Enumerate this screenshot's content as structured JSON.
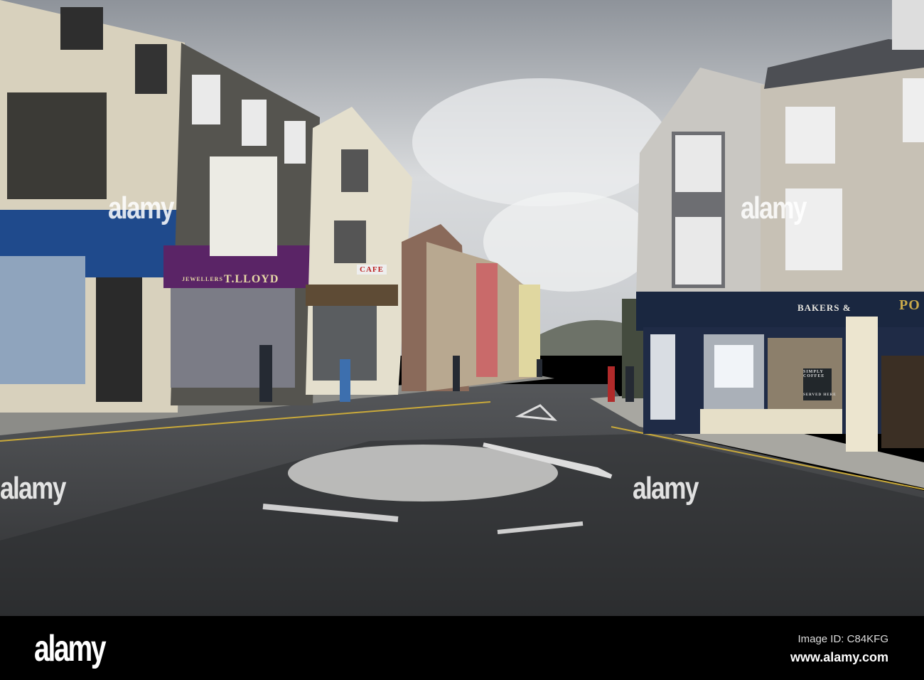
{
  "photo": {
    "subject": "town-street-roundabout",
    "shop_signs": {
      "lloyd": "T.LLOYD",
      "jewellers": "JEWELLERS",
      "cafe": "CAFE",
      "bakers": "BAKERS &",
      "po": "PO",
      "simply_coffee": "SIMPLY COFFEE",
      "served_here": "SERVED HERE"
    },
    "colors": {
      "sky": "#c9ccd0",
      "road": "#3a3b3d",
      "blue_fascia": "#1f4a8c",
      "purple_fascia": "#5a2466",
      "navy_shop": "#1a2740"
    }
  },
  "watermark": {
    "text": "alamy"
  },
  "footer": {
    "logo": "alamy",
    "image_id": "Image ID: C84KFG",
    "site": "www.alamy.com"
  }
}
